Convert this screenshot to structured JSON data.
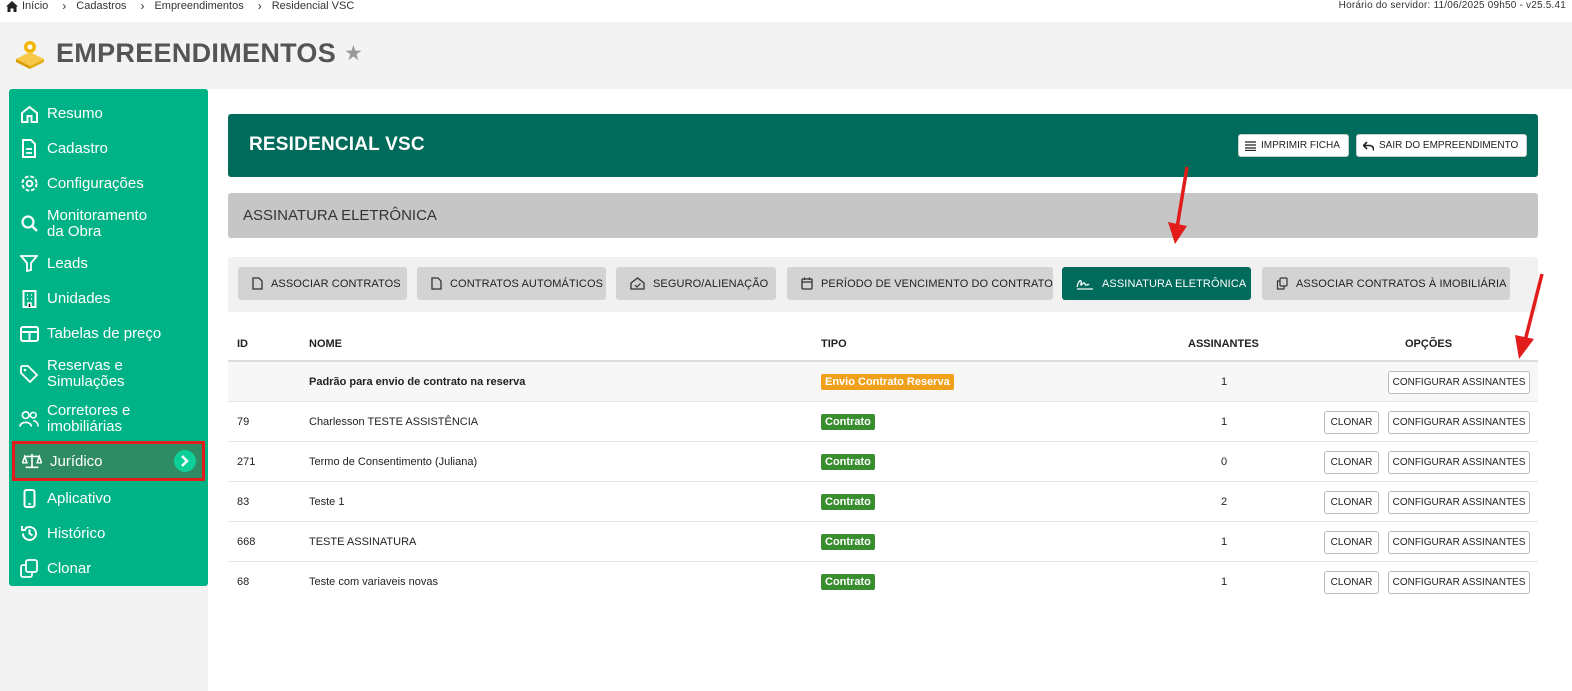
{
  "breadcrumb": {
    "items": [
      "Início",
      "Cadastros",
      "Empreendimentos",
      "Residencial VSC"
    ]
  },
  "server_time": "Horário do servidor: 11/06/2025 09h50 - v25.5.41",
  "page": {
    "title": "EMPREENDIMENTOS"
  },
  "sidebar": {
    "items": [
      {
        "label": "Resumo",
        "icon": "home-icon"
      },
      {
        "label": "Cadastro",
        "icon": "document-icon"
      },
      {
        "label": "Configurações",
        "icon": "gear-icon"
      },
      {
        "label": "Monitoramento da Obra",
        "icon": "search-icon"
      },
      {
        "label": "Leads",
        "icon": "filter-icon"
      },
      {
        "label": "Unidades",
        "icon": "building-icon"
      },
      {
        "label": "Tabelas de preço",
        "icon": "table-icon"
      },
      {
        "label": "Reservas e Simulações",
        "icon": "tag-icon"
      },
      {
        "label": "Corretores e imobiliárias",
        "icon": "users-icon"
      },
      {
        "label": "Jurídico",
        "icon": "scale-icon"
      },
      {
        "label": "Aplicativo",
        "icon": "phone-icon"
      },
      {
        "label": "Histórico",
        "icon": "history-icon"
      },
      {
        "label": "Clonar",
        "icon": "copy-icon"
      }
    ]
  },
  "header": {
    "title": "RESIDENCIAL VSC",
    "print_label": "IMPRIMIR FICHA",
    "exit_label": "SAIR DO EMPREENDIMENTO"
  },
  "section": {
    "title": "ASSINATURA ELETRÔNICA"
  },
  "tabs": [
    {
      "label": "ASSOCIAR CONTRATOS"
    },
    {
      "label": "CONTRATOS AUTOMÁTICOS"
    },
    {
      "label": "SEGURO/ALIENAÇÃO"
    },
    {
      "label": "PERÍODO DE VENCIMENTO DO CONTRATO"
    },
    {
      "label": "ASSINATURA ELETRÔNICA"
    },
    {
      "label": "ASSOCIAR CONTRATOS À IMOBILIÁRIA"
    }
  ],
  "table": {
    "headers": {
      "id": "ID",
      "name": "NOME",
      "type": "TIPO",
      "signers": "ASSINANTES",
      "options": "OPÇÕES"
    },
    "clone_label": "CLONAR",
    "configure_label": "CONFIGURAR ASSINANTES",
    "rows": [
      {
        "id": "",
        "name": "Padrão para envio de contrato na reserva",
        "type": "Envio Contrato Reserva",
        "signers": "1"
      },
      {
        "id": "79",
        "name": "Charlesson TESTE ASSISTÊNCIA",
        "type": "Contrato",
        "signers": "1"
      },
      {
        "id": "271",
        "name": "Termo de Consentimento (Juliana)",
        "type": "Contrato",
        "signers": "0"
      },
      {
        "id": "83",
        "name": "Teste 1",
        "type": "Contrato",
        "signers": "2"
      },
      {
        "id": "668",
        "name": "TESTE ASSINATURA",
        "type": "Contrato",
        "signers": "1"
      },
      {
        "id": "68",
        "name": "Teste com variaveis novas",
        "type": "Contrato",
        "signers": "1"
      }
    ]
  },
  "colors": {
    "sidebar": "#00b386",
    "hero": "#006b5b",
    "badge_contract": "#3a8d2e",
    "badge_reserve": "#f0a01b",
    "highlight": "#e21b1b"
  }
}
